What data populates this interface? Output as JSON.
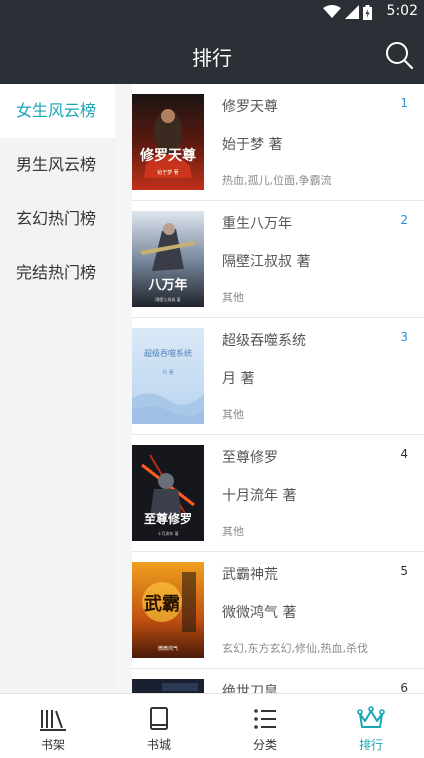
{
  "status_bar": {
    "time": "5:02"
  },
  "header": {
    "title": "排行"
  },
  "sidebar": {
    "items": [
      {
        "label": "女生风云榜",
        "active": true
      },
      {
        "label": "男生风云榜",
        "active": false
      },
      {
        "label": "玄幻热门榜",
        "active": false
      },
      {
        "label": "完结热门榜",
        "active": false
      }
    ]
  },
  "books": [
    {
      "title": "修罗天尊",
      "author": "始于梦 著",
      "tags": "热血,孤儿,位面,争霸流",
      "rank": "1",
      "cover_text": "修罗天尊",
      "cover_sub": "始于梦 著"
    },
    {
      "title": "重生八万年",
      "author": "隔壁江叔叔 著",
      "tags": "其他",
      "rank": "2",
      "cover_text": "八万年",
      "cover_sub": "隔壁江叔叔 著"
    },
    {
      "title": "超级吞噬系统",
      "author": "月 著",
      "tags": "其他",
      "rank": "3",
      "cover_text": "超级吞噬系统",
      "cover_sub": "月 著"
    },
    {
      "title": "至尊修罗",
      "author": "十月流年 著",
      "tags": "其他",
      "rank": "4",
      "cover_text": "至尊修罗",
      "cover_sub": "十月流年 著"
    },
    {
      "title": "武霸神荒",
      "author": "微微鸿气 著",
      "tags": "玄幻,东方玄幻,修仙,热血,杀伐",
      "rank": "5",
      "cover_text": "武霸",
      "cover_sub": "微微鸿气"
    },
    {
      "title": "绝世刀皇",
      "author": "",
      "tags": "",
      "rank": "6",
      "cover_text": "",
      "cover_sub": ""
    }
  ],
  "tabbar": {
    "tabs": [
      {
        "label": "书架",
        "icon": "bookshelf-icon"
      },
      {
        "label": "书城",
        "icon": "book-icon"
      },
      {
        "label": "分类",
        "icon": "list-icon"
      },
      {
        "label": "排行",
        "icon": "crown-icon",
        "active": true
      }
    ]
  },
  "colors": {
    "accent": "#19a6b4",
    "header_bg": "#2b3036",
    "rank_top": "#2e8fd0"
  }
}
